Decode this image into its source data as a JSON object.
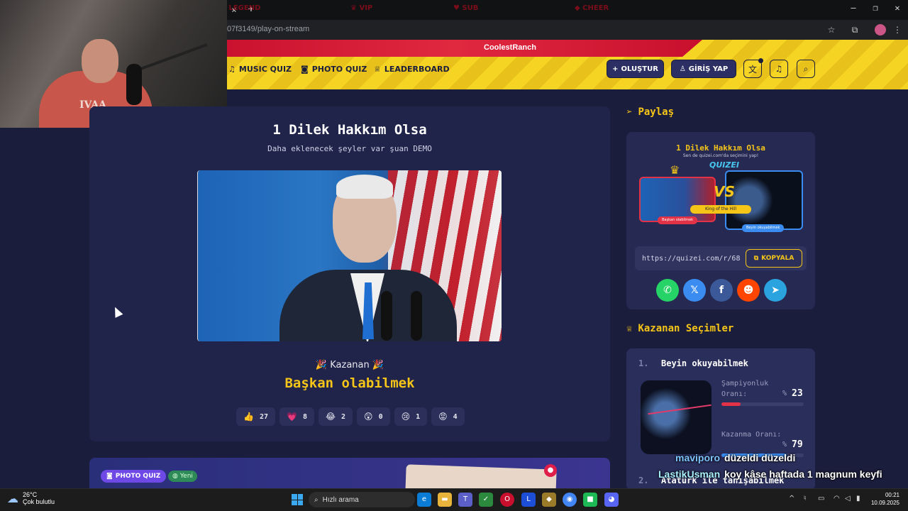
{
  "browser": {
    "url": "07f3149/play-on-stream",
    "tab_close": "×",
    "tab_new": "+",
    "minimize": "—",
    "maximize": "❐",
    "close": "✕"
  },
  "ribbon": {
    "items": [
      "LEGEND",
      "VIP",
      "SUB",
      "CHEER"
    ],
    "sub_user": "CoolestRanch"
  },
  "nav": {
    "music_quiz": "MUSIC QUIZ",
    "photo_quiz": "PHOTO QUIZ",
    "leaderboard": "LEADERBOARD",
    "create": "OLUŞTUR",
    "login": "GİRİŞ YAP"
  },
  "quiz": {
    "title": "1 Dilek Hakkım Olsa",
    "subtitle": "Daha eklenecek şeyler var şuan DEMO",
    "winner_label": "Kazanan",
    "winner_name": "Başkan olabilmek",
    "reactions": [
      {
        "emoji": "👍",
        "count": "27"
      },
      {
        "emoji": "💗",
        "count": "8"
      },
      {
        "emoji": "😂",
        "count": "2"
      },
      {
        "emoji": "😲",
        "count": "0"
      },
      {
        "emoji": "😢",
        "count": "1"
      },
      {
        "emoji": "😡",
        "count": "4"
      }
    ]
  },
  "bottom": {
    "photo_quiz_badge": "PHOTO QUIZ",
    "new_badge": "Yeni"
  },
  "share": {
    "heading": "Paylaş",
    "preview_title": "1 Dilek Hakkım Olsa",
    "preview_sub": "Sen de quizei.com'da seçimini yap!",
    "preview_logo": "QUIZEI",
    "preview_vs": "VS",
    "preview_koth": "King of the Hill",
    "preview_left": "Başkan olabilmek",
    "preview_right": "Beyin okuyabilmek",
    "url": "https://quizei.com/r/68",
    "copy": "KOPYALA",
    "socials": [
      "whatsapp",
      "x",
      "facebook",
      "reddit",
      "telegram"
    ]
  },
  "winners": {
    "heading": "Kazanan Seçimler",
    "items": [
      {
        "rank": "1.",
        "name": "Beyin okuyabilmek",
        "champ_label": "Şampiyonluk Oranı:",
        "champ_value": "23",
        "champ_ratio": 0.23,
        "win_label": "Kazanma Oranı:",
        "win_value": "79",
        "win_ratio": 0.79,
        "pct": "%"
      },
      {
        "rank": "2.",
        "name": "Atatürk ile tanışabilmek"
      }
    ]
  },
  "chat": [
    {
      "user": "maviporo",
      "msg": "düzeldi düzeldi"
    },
    {
      "user": "LastikUsman",
      "msg": "koy kâse haftada 1 magnum keyfi"
    }
  ],
  "webcam": {
    "shirt_text": "IVAA"
  },
  "taskbar": {
    "temp": "26°C",
    "weather": "Çok bulutlu",
    "search": "Hızlı arama",
    "time": "00:21",
    "date": "10.09.2025"
  },
  "colors": {
    "accent": "#f5c518",
    "bg": "#1b1d3c",
    "card": "#20234a",
    "champ_bar": "#e23247",
    "win_bar": "#3a8cf0"
  }
}
